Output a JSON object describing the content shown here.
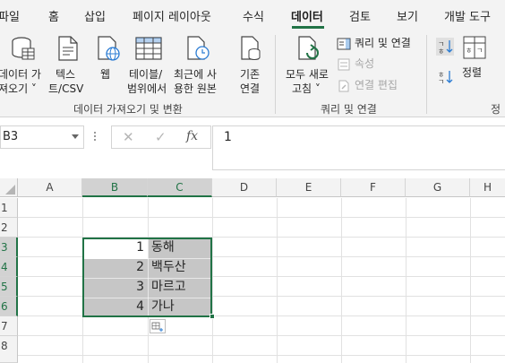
{
  "tabs": [
    {
      "label": "파일"
    },
    {
      "label": "홈"
    },
    {
      "label": "삽입"
    },
    {
      "label": "페이지 레이아웃"
    },
    {
      "label": "수식"
    },
    {
      "label": "데이터",
      "active": true
    },
    {
      "label": "검토"
    },
    {
      "label": "보기"
    },
    {
      "label": "개발 도구"
    }
  ],
  "ribbon": {
    "get_data": {
      "btn1_line1": "데이터 가",
      "btn1_line2": "져오기 ˅",
      "btn2_line1": "텍스",
      "btn2_line2": "트/CSV",
      "btn3_line1": "웹",
      "btn4_line1": "테이블/",
      "btn4_line2": "범위에서",
      "btn5_line1": "최근에 사",
      "btn5_line2": "용한 원본",
      "btn6_line1": "기존",
      "btn6_line2": "연결",
      "group_label": "데이터 가져오기 및 변환"
    },
    "queries": {
      "refresh_line1": "모두 새로",
      "refresh_line2": "고침 ˅",
      "queries_connections": "쿼리 및 연결",
      "properties": "속성",
      "edit_links": "연결 편집",
      "group_label": "쿼리 및 연결"
    },
    "sort": {
      "sort_label": "정렬",
      "group_label_partial": "정"
    }
  },
  "formula_bar": {
    "name_box": "B3",
    "cancel_glyph": "✕",
    "enter_glyph": "✓",
    "fx_label": "fx",
    "content": "1"
  },
  "sheet": {
    "columns": [
      "A",
      "B",
      "C",
      "D",
      "E",
      "F",
      "G",
      "H"
    ],
    "rows": [
      "1",
      "2",
      "3",
      "4",
      "5",
      "6",
      "7",
      "8"
    ],
    "cells": {
      "B3": "1",
      "C3": "동해",
      "B4": "2",
      "C4": "백두산",
      "B5": "3",
      "C5": "마르고",
      "B6": "4",
      "C6": "가나"
    }
  },
  "colors": {
    "accent": "#217346",
    "selection": "#c6c6c6",
    "ribbon_bg": "#f3f3f3"
  }
}
